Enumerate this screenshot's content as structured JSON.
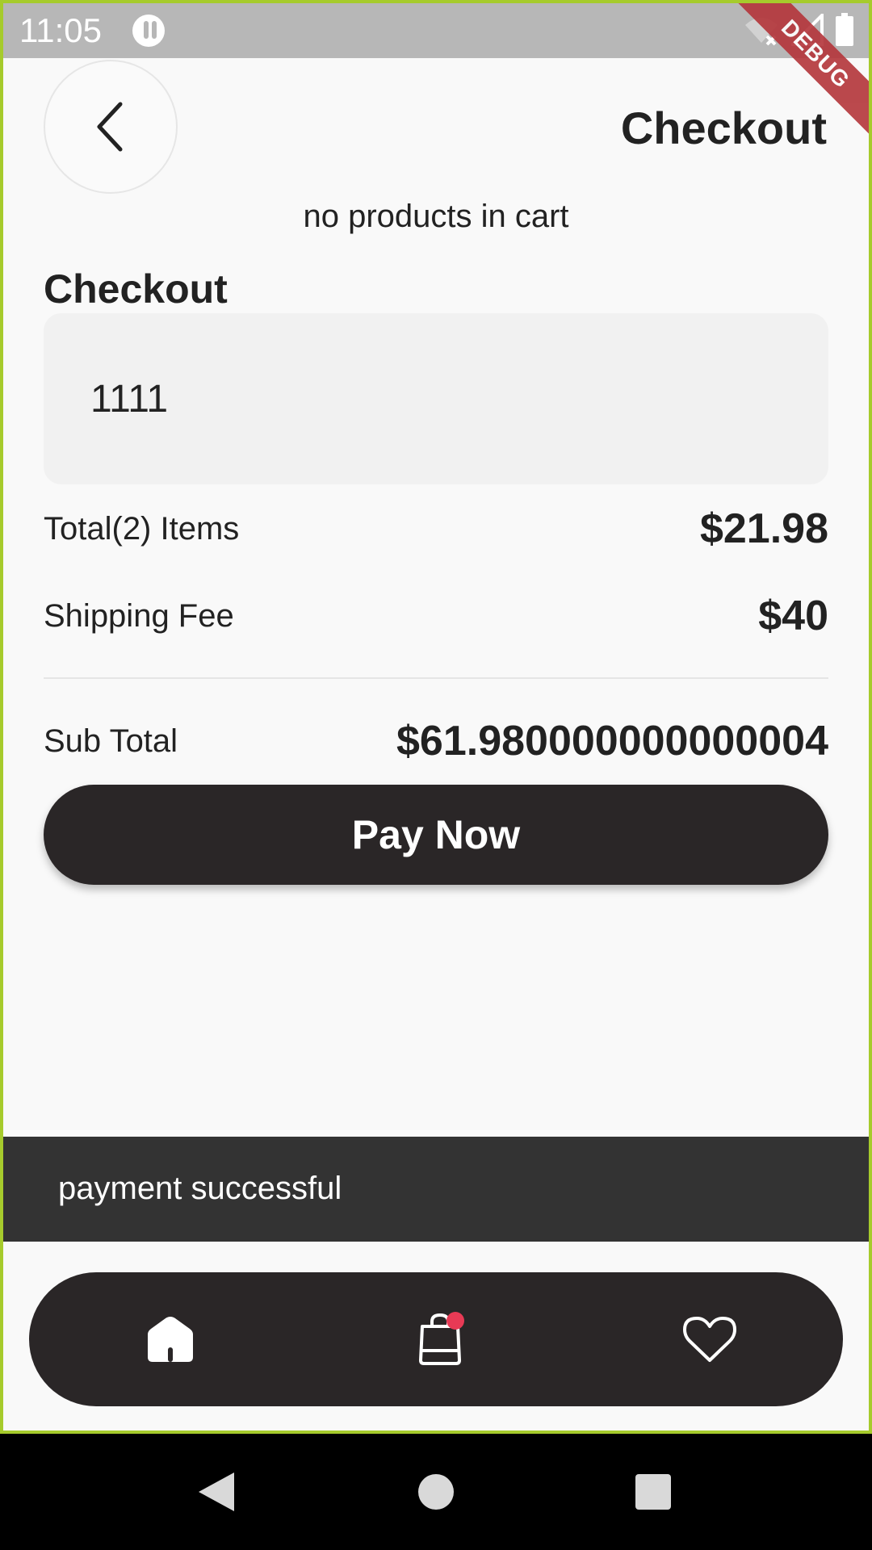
{
  "status_bar": {
    "time": "11:05",
    "icons": [
      "app-notification-icon",
      "wifi-off-icon",
      "signal-icon",
      "battery-icon"
    ]
  },
  "debug_banner": "DEBUG",
  "header": {
    "back_icon": "chevron-left-icon",
    "title": "Checkout"
  },
  "cart": {
    "empty_message": "no products in cart"
  },
  "checkout": {
    "section_title": "Checkout",
    "card_input_value": "1111",
    "items_label": "Total(2) Items",
    "items_value": "$21.98",
    "shipping_label": "Shipping Fee",
    "shipping_value": "$40",
    "subtotal_label": "Sub Total",
    "subtotal_value": "$61.980000000000004",
    "pay_button_label": "Pay Now"
  },
  "snackbar": {
    "message": "payment successful"
  },
  "bottom_nav": {
    "items": [
      {
        "icon": "home-icon"
      },
      {
        "icon": "shopping-bag-icon",
        "badge": true
      },
      {
        "icon": "heart-icon"
      }
    ]
  },
  "system_nav": {
    "icons": [
      "back-triangle-icon",
      "home-circle-icon",
      "recents-square-icon"
    ]
  },
  "colors": {
    "accent_dark": "#2a2627",
    "badge": "#e83a55",
    "snackbar_bg": "#333333",
    "debug_ribbon": "#b4353a"
  }
}
